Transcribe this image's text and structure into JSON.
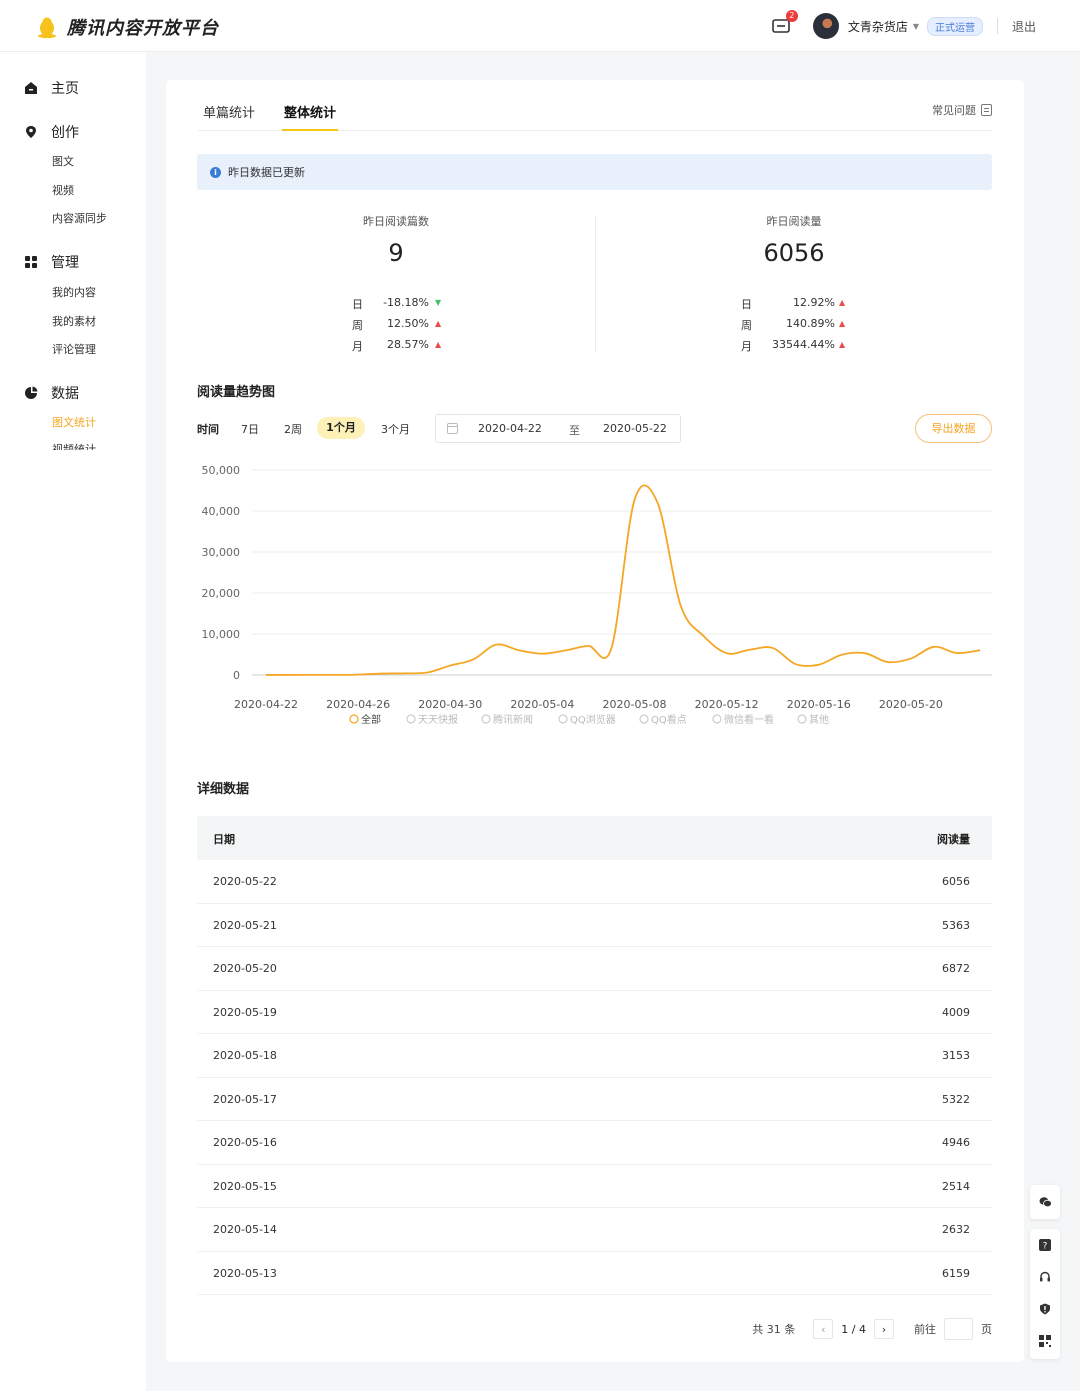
{
  "header": {
    "brand": "腾讯内容开放平台",
    "mail_badge": "2",
    "user_name": "文青杂货店",
    "status_badge": "正式运营",
    "logout": "退出"
  },
  "sidebar": {
    "home": "主页",
    "create": "创作",
    "create_items": [
      "图文",
      "视频",
      "内容源同步"
    ],
    "manage": "管理",
    "manage_items": [
      "我的内容",
      "我的素材",
      "评论管理"
    ],
    "data": "数据",
    "data_items": [
      "图文统计",
      "视频统计"
    ]
  },
  "tabs": {
    "single": "单篇统计",
    "overall": "整体统计",
    "faq": "常见问题"
  },
  "notice": "昨日数据已更新",
  "stats": {
    "left": {
      "title": "昨日阅读篇数",
      "value": "9",
      "rows": [
        {
          "label": "日",
          "pct": "-18.18%",
          "dir": "down"
        },
        {
          "label": "周",
          "pct": "12.50%",
          "dir": "up"
        },
        {
          "label": "月",
          "pct": "28.57%",
          "dir": "up"
        }
      ]
    },
    "right": {
      "title": "昨日阅读量",
      "value": "6056",
      "rows": [
        {
          "label": "日",
          "pct": "12.92%",
          "dir": "up"
        },
        {
          "label": "周",
          "pct": "140.89%",
          "dir": "up"
        },
        {
          "label": "月",
          "pct": "33544.44%",
          "dir": "up"
        }
      ]
    }
  },
  "trend": {
    "title": "阅读量趋势图",
    "time_label": "时间",
    "ranges": [
      "7日",
      "2周",
      "1个月",
      "3个月"
    ],
    "active_range": "1个月",
    "date_start": "2020-04-22",
    "date_sep": "至",
    "date_end": "2020-05-22",
    "export_label": "导出数据"
  },
  "chart_data": {
    "type": "line",
    "ylim": [
      0,
      50000
    ],
    "yticks": [
      "50,000",
      "40,000",
      "30,000",
      "20,000",
      "10,000",
      "0"
    ],
    "xticks": [
      "2020-04-22",
      "2020-04-26",
      "2020-04-30",
      "2020-05-04",
      "2020-05-08",
      "2020-05-12",
      "2020-05-16",
      "2020-05-20"
    ],
    "x": [
      "2020-04-22",
      "2020-04-23",
      "2020-04-24",
      "2020-04-25",
      "2020-04-26",
      "2020-04-27",
      "2020-04-28",
      "2020-04-29",
      "2020-04-30",
      "2020-05-01",
      "2020-05-02",
      "2020-05-03",
      "2020-05-04",
      "2020-05-05",
      "2020-05-06",
      "2020-05-07",
      "2020-05-08",
      "2020-05-09",
      "2020-05-10",
      "2020-05-11",
      "2020-05-12",
      "2020-05-13",
      "2020-05-14",
      "2020-05-15",
      "2020-05-16",
      "2020-05-17",
      "2020-05-18",
      "2020-05-19",
      "2020-05-20",
      "2020-05-21",
      "2020-05-22"
    ],
    "series": [
      {
        "name": "全部",
        "color": "#f5a623",
        "values": [
          18,
          20,
          25,
          30,
          100,
          350,
          400,
          600,
          2300,
          3800,
          7400,
          6000,
          5200,
          6000,
          7100,
          6600,
          42700,
          42000,
          17000,
          9500,
          5300,
          6159,
          6600,
          2632,
          2514,
          4946,
          5322,
          3153,
          4009,
          6872,
          5363,
          6056
        ]
      }
    ],
    "legend": [
      {
        "name": "全部",
        "active": true
      },
      {
        "name": "天天快报",
        "active": false
      },
      {
        "name": "腾讯新闻",
        "active": false
      },
      {
        "name": "QQ浏览器",
        "active": false
      },
      {
        "name": "QQ看点",
        "active": false
      },
      {
        "name": "微信看一看",
        "active": false
      },
      {
        "name": "其他",
        "active": false
      }
    ]
  },
  "details": {
    "title": "详细数据",
    "col_date": "日期",
    "col_reads": "阅读量",
    "rows": [
      {
        "date": "2020-05-22",
        "reads": "6056"
      },
      {
        "date": "2020-05-21",
        "reads": "5363"
      },
      {
        "date": "2020-05-20",
        "reads": "6872"
      },
      {
        "date": "2020-05-19",
        "reads": "4009"
      },
      {
        "date": "2020-05-18",
        "reads": "3153"
      },
      {
        "date": "2020-05-17",
        "reads": "5322"
      },
      {
        "date": "2020-05-16",
        "reads": "4946"
      },
      {
        "date": "2020-05-15",
        "reads": "2514"
      },
      {
        "date": "2020-05-14",
        "reads": "2632"
      },
      {
        "date": "2020-05-13",
        "reads": "6159"
      }
    ]
  },
  "pager": {
    "total": "共 31 条",
    "page": "1 / 4",
    "goto": "前往",
    "unit": "页"
  },
  "colors": {
    "accent": "#f5a623",
    "tab_underline": "#f5c518",
    "up": "#ef4b4b",
    "down": "#43c26b"
  }
}
